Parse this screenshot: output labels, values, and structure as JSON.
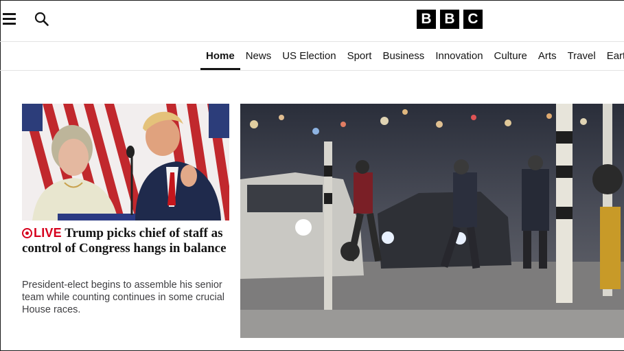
{
  "header": {
    "menu_icon": "hamburger-menu-icon",
    "search_icon": "search-icon",
    "logo_letters": [
      "B",
      "B",
      "C"
    ]
  },
  "nav": {
    "items": [
      {
        "label": "Home",
        "active": true
      },
      {
        "label": "News"
      },
      {
        "label": "US Election"
      },
      {
        "label": "Sport"
      },
      {
        "label": "Business"
      },
      {
        "label": "Innovation"
      },
      {
        "label": "Culture"
      },
      {
        "label": "Arts"
      },
      {
        "label": "Travel"
      },
      {
        "label": "Earth"
      }
    ]
  },
  "main": {
    "lead_story": {
      "live_label": "LIVE",
      "headline": "Trump picks chief of staff as control of Congress hangs in balance",
      "summary": "President-elect begins to assemble his senior team while counting continues in some crucial House races.",
      "live_color": "#d6001c"
    }
  }
}
